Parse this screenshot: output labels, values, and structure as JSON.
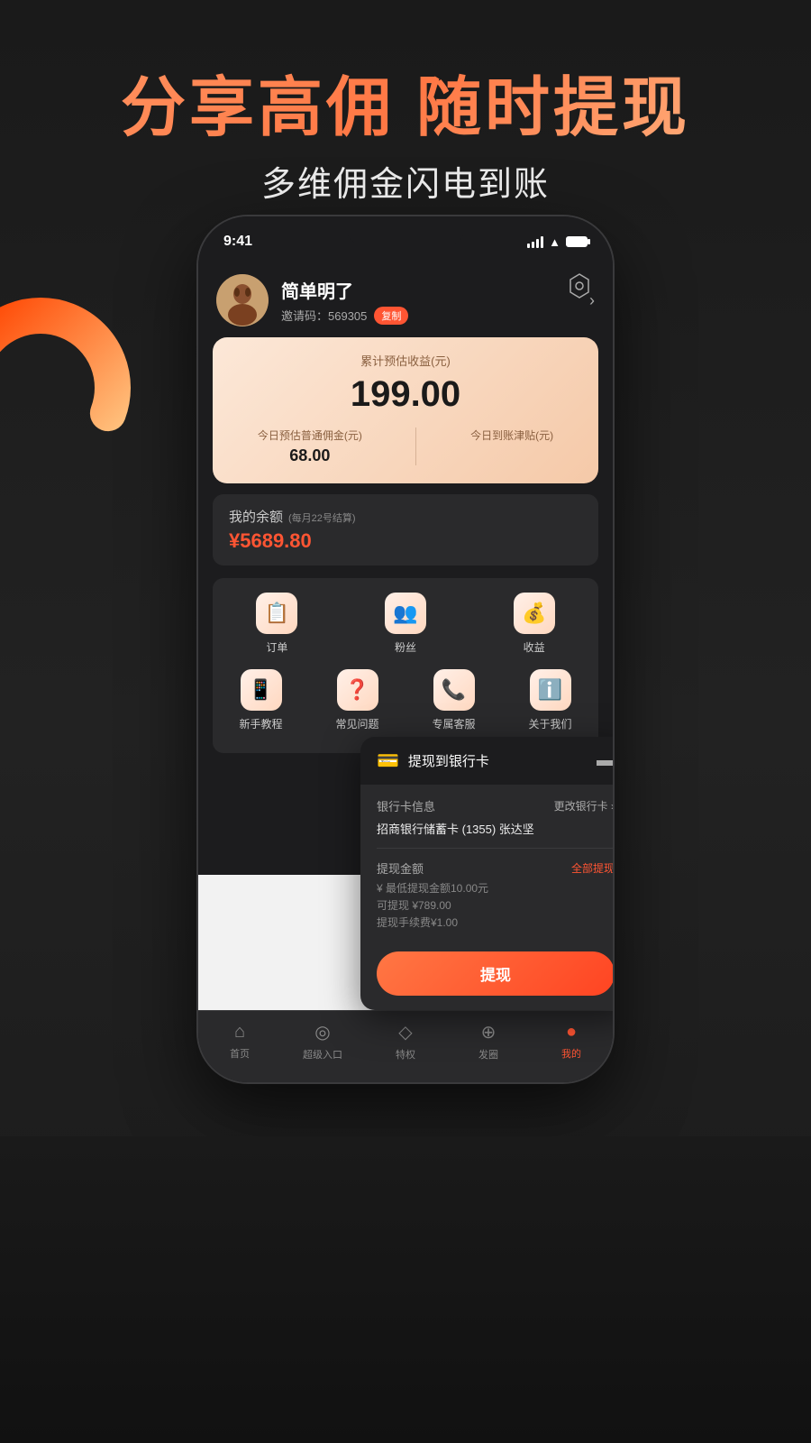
{
  "hero": {
    "main_title": "分享高佣 随时提现",
    "sub_title": "多维佣金闪电到账"
  },
  "status_bar": {
    "time": "9:41",
    "signal": "●●●●",
    "wifi": "wifi",
    "battery": "battery"
  },
  "user": {
    "name": "简单明了",
    "invite_label": "邀请码：",
    "invite_code": "569305",
    "copy_btn": "复制"
  },
  "earnings": {
    "title": "累计预估收益(元)",
    "amount": "199.00",
    "commission_label": "今日预估普通佣金(元)",
    "commission_value": "68.00",
    "subsidy_label": "今日到账津贴(元)",
    "subsidy_value": ""
  },
  "balance": {
    "label": "我的余额",
    "sub_label": "(每月22号结算)",
    "amount": "¥5689.80"
  },
  "menu_row1": [
    {
      "icon": "📋",
      "label": "订单"
    },
    {
      "icon": "👤",
      "label": "粉丝"
    },
    {
      "icon": "💰",
      "label": "收益"
    }
  ],
  "menu_row2": [
    {
      "icon": "📱",
      "label": "新手教程"
    },
    {
      "icon": "❓",
      "label": "常见问题"
    },
    {
      "icon": "📞",
      "label": "专属客服"
    },
    {
      "icon": "ℹ️",
      "label": "关于我们"
    }
  ],
  "bottom_nav": [
    {
      "icon": "⌂",
      "label": "首页",
      "active": false
    },
    {
      "icon": "◎",
      "label": "超级入口",
      "active": false
    },
    {
      "icon": "◇",
      "label": "特权",
      "active": false
    },
    {
      "icon": "⊕",
      "label": "发圈",
      "active": false
    },
    {
      "icon": "●",
      "label": "我的",
      "active": true
    }
  ],
  "popup": {
    "title": "提现到银行卡",
    "bank_section": "银行卡信息",
    "change_bank": "更改银行卡 ›",
    "bank_name": "招商银行储蓄卡 (1355)  张达坚",
    "amount_section": "提现金额",
    "min_note": "¥ 最低提现金额10.00元",
    "full_withdraw": "全部提现",
    "available": "可提现 ¥789.00",
    "fee": "提现手续费¥1.00",
    "withdraw_btn": "提现"
  }
}
